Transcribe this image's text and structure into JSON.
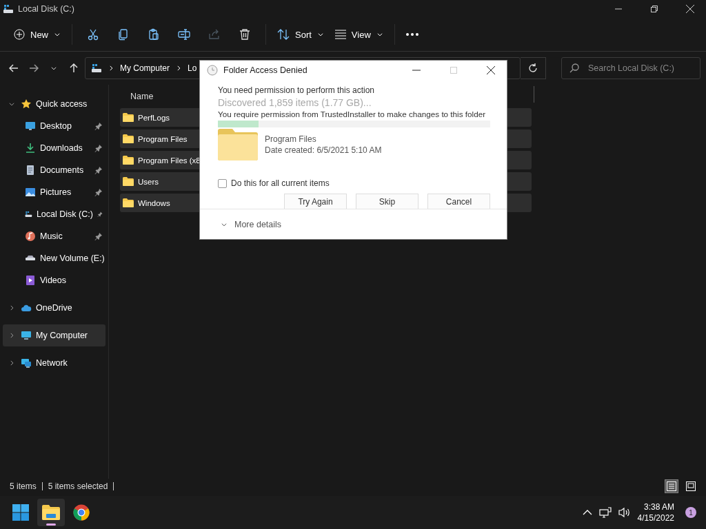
{
  "window": {
    "title": "Local Disk (C:)"
  },
  "toolbar": {
    "new_label": "New",
    "icon_buttons": [
      {
        "kind": "cut",
        "disabled": false
      },
      {
        "kind": "copy",
        "disabled": false
      },
      {
        "kind": "paste",
        "disabled": false
      },
      {
        "kind": "rename",
        "disabled": false
      },
      {
        "kind": "share",
        "disabled": true
      },
      {
        "kind": "delete",
        "disabled": false
      }
    ],
    "sort_label": "Sort",
    "view_label": "View"
  },
  "address": {
    "breadcrumb": [
      "My Computer",
      "Lo"
    ],
    "search_placeholder": "Search Local Disk (C:)"
  },
  "sidebar": {
    "items": [
      {
        "label": "Quick access",
        "kind": "star",
        "expanded": true,
        "selected": false,
        "children": [
          {
            "label": "Desktop",
            "kind": "desktop",
            "pinned": true,
            "selected": false
          },
          {
            "label": "Downloads",
            "kind": "download",
            "pinned": true,
            "selected": false
          },
          {
            "label": "Documents",
            "kind": "document",
            "pinned": true,
            "selected": false
          },
          {
            "label": "Pictures",
            "kind": "pictures",
            "pinned": true,
            "selected": false
          },
          {
            "label": "Local Disk (C:)",
            "kind": "disk",
            "pinned": true,
            "selected": false
          },
          {
            "label": "Music",
            "kind": "music",
            "pinned": true,
            "selected": false
          },
          {
            "label": "New Volume (E:)",
            "kind": "drive",
            "pinned": false,
            "selected": false
          },
          {
            "label": "Videos",
            "kind": "video",
            "pinned": false,
            "selected": false
          }
        ]
      },
      {
        "label": "OneDrive",
        "kind": "cloud",
        "expanded": false,
        "selected": false
      },
      {
        "label": "My Computer",
        "kind": "computer",
        "expanded": false,
        "selected": true
      },
      {
        "label": "Network",
        "kind": "network",
        "expanded": false,
        "selected": false
      }
    ]
  },
  "file_list": {
    "columns": [
      "Name"
    ],
    "rows": [
      {
        "name": "PerfLogs",
        "selected": true
      },
      {
        "name": "Program Files",
        "selected": true
      },
      {
        "name": "Program Files (x8",
        "selected": true
      },
      {
        "name": "Users",
        "selected": true
      },
      {
        "name": "Windows",
        "selected": true
      }
    ]
  },
  "status_bar": {
    "item_count": "5 items",
    "selection": "5 items selected",
    "views": [
      {
        "kind": "details",
        "selected": true
      },
      {
        "kind": "tiles",
        "selected": false
      }
    ]
  },
  "dialog": {
    "title": "Folder Access Denied",
    "heading": "You need permission to perform this action",
    "ghost_text": "Discovered 1,859 items (1.77 GB)...",
    "level": 0.15,
    "message": "You require permission from TrustedInstaller to make changes to this folder",
    "file_name": "Program Files",
    "file_date": "Date created: 6/5/2021 5:10 AM",
    "checkbox": {
      "label": "Do this for all current items",
      "checked": false
    },
    "buttons": [
      "Try Again",
      "Skip",
      "Cancel"
    ],
    "more_details": "More details"
  },
  "taskbar": {
    "apps": [
      {
        "kind": "start",
        "active": false
      },
      {
        "kind": "explorer",
        "active": true
      },
      {
        "kind": "browser",
        "active": false
      }
    ],
    "time": "3:38 AM",
    "date": "4/15/2022",
    "notification_count": "1"
  }
}
